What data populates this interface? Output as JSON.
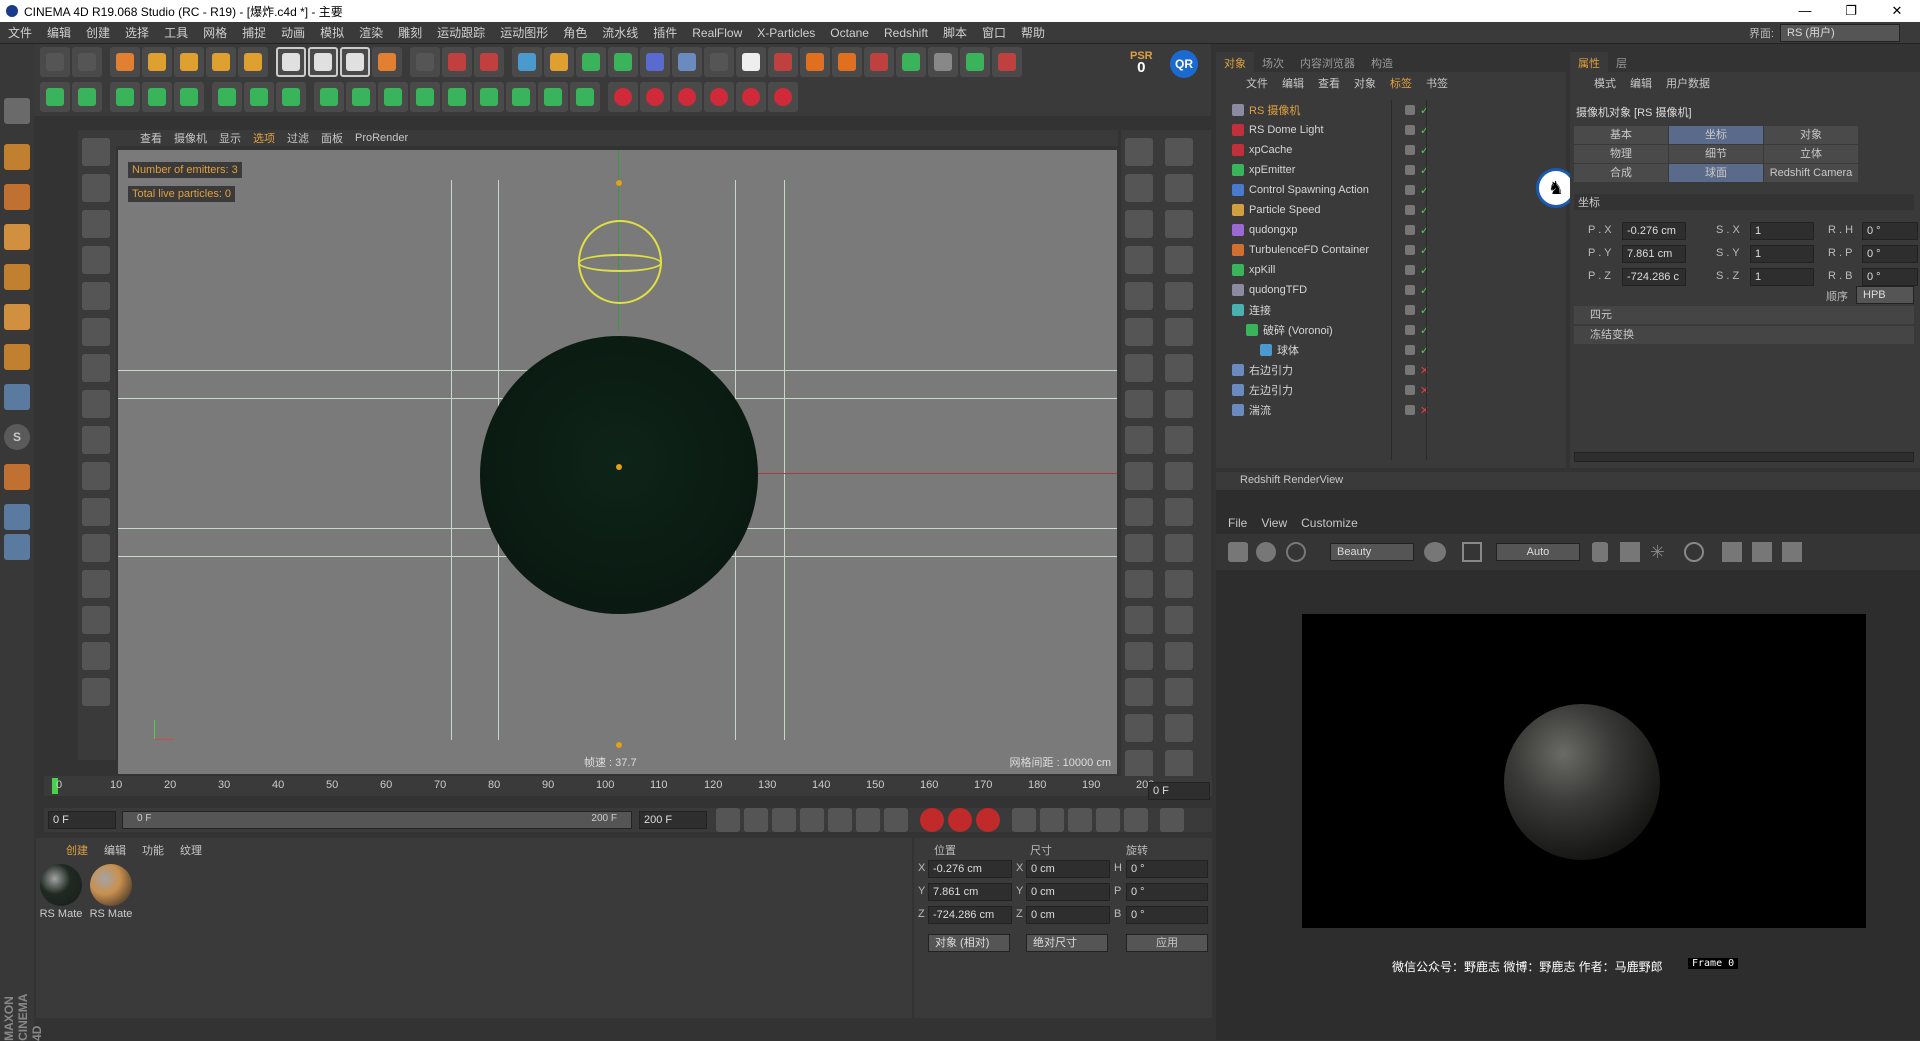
{
  "window": {
    "title": "CINEMA 4D R19.068 Studio (RC - R19) - [爆炸.c4d *] - 主要",
    "min": "—",
    "max": "❐",
    "close": "✕"
  },
  "menu": [
    "文件",
    "编辑",
    "创建",
    "选择",
    "工具",
    "网格",
    "捕捉",
    "动画",
    "模拟",
    "渲染",
    "雕刻",
    "运动跟踪",
    "运动图形",
    "角色",
    "流水线",
    "插件",
    "RealFlow",
    "X-Particles",
    "Octane",
    "Redshift",
    "脚本",
    "窗口",
    "帮助"
  ],
  "layout": {
    "label": "界面:",
    "value": "RS (用户)"
  },
  "toolbar": {
    "psr_label": "PSR",
    "psr_value": "0",
    "qr_label": "QR"
  },
  "viewport": {
    "menu": [
      "查看",
      "摄像机",
      "显示",
      "选项",
      "过滤",
      "面板",
      "ProRender"
    ],
    "hud_emitters": "Number of emitters: 3",
    "hud_particles": "Total live particles: 0",
    "fps": "帧速 : 37.7",
    "grid": "网格间距 : 10000 cm"
  },
  "timeline": {
    "ticks": [
      "0",
      "10",
      "20",
      "30",
      "40",
      "50",
      "60",
      "70",
      "80",
      "90",
      "100",
      "110",
      "120",
      "130",
      "140",
      "150",
      "160",
      "170",
      "180",
      "190",
      "200"
    ],
    "current": "0 F",
    "start": "0 F",
    "slider_start": "0 F",
    "slider_end": "200 F",
    "end": "200 F"
  },
  "materials": {
    "menu": [
      "创建",
      "编辑",
      "功能",
      "纹理"
    ],
    "items": [
      {
        "label": "RS Mate",
        "color": "#1f2a22"
      },
      {
        "label": "RS Mate",
        "color": "#c9904f"
      }
    ]
  },
  "coords": {
    "headers": [
      "位置",
      "尺寸",
      "旋转"
    ],
    "rows": [
      {
        "axis": "X",
        "pos": "-0.276 cm",
        "size_axis": "X",
        "size": "0 cm",
        "rot_axis": "H",
        "rot": "0 °"
      },
      {
        "axis": "Y",
        "pos": "7.861 cm",
        "size_axis": "Y",
        "size": "0 cm",
        "rot_axis": "P",
        "rot": "0 °"
      },
      {
        "axis": "Z",
        "pos": "-724.286 cm",
        "size_axis": "Z",
        "size": "0 cm",
        "rot_axis": "B",
        "rot": "0 °"
      }
    ],
    "mode1": "对象 (相对)",
    "mode2": "绝对尺寸",
    "apply": "应用"
  },
  "objects": {
    "tabs": [
      "对象",
      "场次",
      "内容浏览器",
      "构造"
    ],
    "menu": [
      "文件",
      "编辑",
      "查看",
      "对象",
      "标签",
      "书签"
    ],
    "items": [
      {
        "name": "RS 摄像机",
        "icon": "#8a8aa0",
        "indent": 0,
        "active": true
      },
      {
        "name": "RS Dome Light",
        "icon": "#c0303a",
        "indent": 0
      },
      {
        "name": "xpCache",
        "icon": "#c0303a",
        "indent": 0
      },
      {
        "name": "xpEmitter",
        "icon": "#3ab45a",
        "indent": 0
      },
      {
        "name": "Control Spawning Action",
        "icon": "#4a7ad0",
        "indent": 0
      },
      {
        "name": "Particle Speed",
        "icon": "#d0a040",
        "indent": 0
      },
      {
        "name": "qudongxp",
        "icon": "#9a6ad0",
        "indent": 0
      },
      {
        "name": "TurbulenceFD Container",
        "icon": "#d07030",
        "indent": 0
      },
      {
        "name": "xpKill",
        "icon": "#3ab45a",
        "indent": 0
      },
      {
        "name": "qudongTFD",
        "icon": "#8a8aa0",
        "indent": 0
      },
      {
        "name": "连接",
        "icon": "#4ab0b0",
        "indent": 0
      },
      {
        "name": "破碎 (Voronoi)",
        "icon": "#3ab45a",
        "indent": 1
      },
      {
        "name": "球体",
        "icon": "#4a9ad0",
        "indent": 2
      },
      {
        "name": "右边引力",
        "icon": "#6a8ac0",
        "indent": 0
      },
      {
        "name": "左边引力",
        "icon": "#6a8ac0",
        "indent": 0
      },
      {
        "name": "湍流",
        "icon": "#6a8ac0",
        "indent": 0
      }
    ]
  },
  "attributes": {
    "tabs": [
      "属性",
      "层"
    ],
    "menu": [
      "模式",
      "编辑",
      "用户数据"
    ],
    "title": "摄像机对象 [RS 摄像机]",
    "subtabs": [
      "基本",
      "坐标",
      "对象",
      "物理",
      "细节",
      "立体",
      "合成",
      "球面",
      "Redshift Camera"
    ],
    "section": "坐标",
    "fields": [
      {
        "l1": "P . X",
        "v1": "-0.276 cm",
        "l2": "S . X",
        "v2": "1",
        "l3": "R . H",
        "v3": "0 °"
      },
      {
        "l1": "P . Y",
        "v1": "7.861 cm",
        "l2": "S . Y",
        "v2": "1",
        "l3": "R . P",
        "v3": "0 °"
      },
      {
        "l1": "P . Z",
        "v1": "-724.286 c",
        "l2": "S . Z",
        "v2": "1",
        "l3": "R . B",
        "v3": "0 °"
      }
    ],
    "order_label": "顺序",
    "order_value": "HPB",
    "collapsed": [
      "四元",
      "冻结变换"
    ]
  },
  "renderview": {
    "title": "Redshift RenderView",
    "menu": [
      "File",
      "View",
      "Customize"
    ],
    "aov": "Beauty",
    "zoom": "Auto",
    "footer": "微信公众号：野鹿志   微博：野鹿志   作者：马鹿野郎",
    "frame": "Frame  0"
  },
  "sidebar_brand": "MAXON CINEMA 4D"
}
